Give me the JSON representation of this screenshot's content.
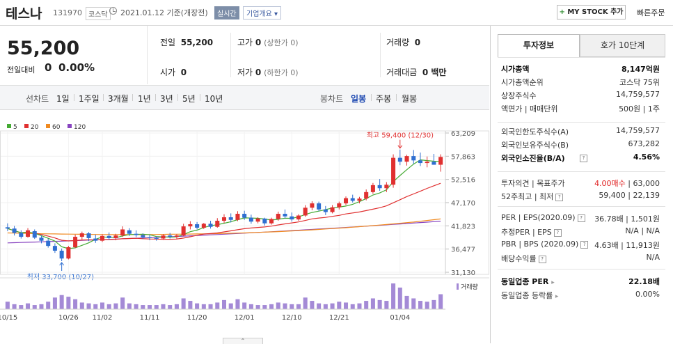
{
  "header": {
    "name": "테스나",
    "code": "131970",
    "market": "코스닥",
    "date": "2021.01.12 기준(개장전)",
    "realtime": "실시간",
    "company_info": "기업개요 ▾",
    "mystock": "MY STOCK 추가",
    "fast_order": "빠른주문"
  },
  "price": {
    "current": "55,200",
    "change_label": "전일대비",
    "change": "0",
    "change_pct": "0.00%"
  },
  "quote": {
    "prev_label": "전일",
    "prev": "55,200",
    "high_label": "고가",
    "high": "0",
    "upper": "(상한가 0)",
    "volume_label": "거래량",
    "volume": "0",
    "open_label": "시가",
    "open": "0",
    "low_label": "저가",
    "low": "0",
    "lower": "(하한가 0)",
    "amount_label": "거래대금",
    "amount": "0 백만"
  },
  "chart_tabs": {
    "line_label": "선차트",
    "line": [
      "1일",
      "1주일",
      "3개월",
      "1년",
      "3년",
      "5년",
      "10년"
    ],
    "candle_label": "봉차트",
    "candle": [
      "일봉",
      "주봉",
      "월봉"
    ],
    "active": "일봉"
  },
  "chart_data": {
    "type": "candlestick",
    "legend": [
      {
        "name": "5",
        "color": "#44aa33"
      },
      {
        "name": "20",
        "color": "#e03030"
      },
      {
        "name": "60",
        "color": "#f08a20"
      },
      {
        "name": "120",
        "color": "#8844c0"
      }
    ],
    "y_ticks": [
      "63,209",
      "57,863",
      "52,516",
      "47,170",
      "41,823",
      "36,477",
      "31,130"
    ],
    "ylim": [
      31130,
      63209
    ],
    "x_labels": [
      "10/15",
      "10/26",
      "11/02",
      "11/11",
      "11/20",
      "12/01",
      "12/10",
      "12/21",
      "01/04"
    ],
    "max_label": "최고 59,400 (12/30)",
    "min_label": "최저 33,700 (10/27)",
    "volume_label": "거래량",
    "candles": [
      [
        41500,
        42400,
        40600,
        41200
      ],
      [
        41200,
        41800,
        39600,
        40200
      ],
      [
        40200,
        40800,
        38900,
        39300
      ],
      [
        39300,
        41300,
        39100,
        40800
      ],
      [
        40600,
        41000,
        38800,
        39100
      ],
      [
        39100,
        39600,
        37800,
        38400
      ],
      [
        38400,
        38900,
        36800,
        37200
      ],
      [
        37200,
        37800,
        35600,
        36100
      ],
      [
        36100,
        36600,
        33700,
        34300
      ],
      [
        34300,
        37200,
        34100,
        36900
      ],
      [
        36900,
        39800,
        36700,
        39300
      ],
      [
        39300,
        40500,
        38700,
        40100
      ],
      [
        40100,
        40400,
        38300,
        39000
      ],
      [
        38900,
        39800,
        37900,
        38400
      ],
      [
        38400,
        39900,
        38100,
        39500
      ],
      [
        39500,
        40300,
        38600,
        39000
      ],
      [
        39000,
        40000,
        38500,
        39600
      ],
      [
        39600,
        41700,
        39300,
        41000
      ],
      [
        40800,
        41300,
        39500,
        40000
      ],
      [
        40000,
        40800,
        39200,
        39700
      ],
      [
        39700,
        40100,
        38800,
        39200
      ],
      [
        39200,
        39800,
        38500,
        39000
      ],
      [
        39000,
        39400,
        38400,
        38900
      ],
      [
        38900,
        39900,
        38600,
        39600
      ],
      [
        39600,
        40200,
        38900,
        39300
      ],
      [
        39300,
        39900,
        38800,
        39600
      ],
      [
        39600,
        42300,
        39400,
        41700
      ],
      [
        41700,
        42900,
        41000,
        42200
      ],
      [
        42200,
        42700,
        41000,
        41400
      ],
      [
        41400,
        42500,
        41100,
        42300
      ],
      [
        42300,
        43000,
        41200,
        41600
      ],
      [
        41600,
        43600,
        41400,
        43000
      ],
      [
        43000,
        44500,
        42500,
        43800
      ],
      [
        43800,
        44700,
        42600,
        43200
      ],
      [
        43200,
        45200,
        42900,
        44600
      ],
      [
        44600,
        45300,
        43200,
        43700
      ],
      [
        43700,
        44400,
        42300,
        42800
      ],
      [
        42800,
        43800,
        42400,
        43500
      ],
      [
        43500,
        43700,
        41900,
        42400
      ],
      [
        42400,
        43700,
        42100,
        43400
      ],
      [
        43400,
        45100,
        43000,
        44600
      ],
      [
        44600,
        45600,
        43500,
        44000
      ],
      [
        44000,
        44900,
        42800,
        43300
      ],
      [
        43300,
        44500,
        43000,
        44200
      ],
      [
        44200,
        46600,
        43900,
        46000
      ],
      [
        46000,
        47500,
        45400,
        47000
      ],
      [
        47000,
        47400,
        45200,
        45600
      ],
      [
        45600,
        46400,
        44300,
        45000
      ],
      [
        45000,
        46600,
        44700,
        46100
      ],
      [
        46100,
        47400,
        45600,
        47000
      ],
      [
        47000,
        48600,
        46600,
        48200
      ],
      [
        48200,
        49000,
        47200,
        47600
      ],
      [
        47600,
        48500,
        47000,
        48100
      ],
      [
        48100,
        50200,
        47700,
        49600
      ],
      [
        49600,
        51700,
        49200,
        51200
      ],
      [
        51200,
        52600,
        49900,
        50500
      ],
      [
        50500,
        51900,
        49600,
        51300
      ],
      [
        51300,
        58300,
        50600,
        57500
      ],
      [
        57500,
        59400,
        55800,
        56600
      ],
      [
        56600,
        58200,
        55700,
        57900
      ],
      [
        57900,
        59300,
        56100,
        56900
      ],
      [
        56900,
        58700,
        55600,
        56300
      ],
      [
        56300,
        57800,
        55300,
        56600
      ],
      [
        56600,
        58400,
        55900,
        55900
      ],
      [
        55900,
        58300,
        54300,
        57700
      ]
    ],
    "volumes": [
      9,
      6,
      5,
      7,
      5,
      6,
      9,
      14,
      17,
      15,
      12,
      8,
      7,
      6,
      8,
      6,
      7,
      14,
      7,
      6,
      5,
      5,
      5,
      6,
      5,
      6,
      13,
      10,
      7,
      6,
      6,
      8,
      11,
      7,
      12,
      8,
      6,
      5,
      5,
      6,
      8,
      7,
      6,
      6,
      14,
      10,
      7,
      6,
      7,
      9,
      8,
      6,
      7,
      10,
      13,
      11,
      10,
      31,
      26,
      16,
      13,
      10,
      9,
      11,
      18
    ]
  },
  "right": {
    "tab_invest": "투자정보",
    "tab_quote": "호가 10단계",
    "rows1": [
      {
        "k": "시가총액",
        "v": "8,147억원",
        "strong": true
      },
      {
        "k": "시가총액순위",
        "v": "코스닥 75위"
      },
      {
        "k": "상장주식수",
        "v": "14,759,577"
      },
      {
        "k": "액면가 | 매매단위",
        "v": "500원 | 1주"
      }
    ],
    "rows2": [
      {
        "k": "외국인한도주식수(A)",
        "v": "14,759,577"
      },
      {
        "k": "외국인보유주식수(B)",
        "v": "673,282"
      },
      {
        "k": "외국인소진율(B/A)",
        "v": "4.56%",
        "strong": true
      }
    ],
    "opinion_label": "투자의견 | 목표주가",
    "opinion": "4.00매수",
    "target": "63,000",
    "w52_label": "52주최고 | 최저",
    "w52": "59,400 | 22,139",
    "per_label": "PER | EPS(2020.09)",
    "per": "36.78배 | 1,501원",
    "eper_label": "추정PER | EPS",
    "eper": "N/A | N/A",
    "pbr_label": "PBR | BPS (2020.09)",
    "pbr": "4.63배 | 11,913원",
    "div_label": "배당수익률",
    "div": "N/A",
    "sector_per_label": "동일업종 PER",
    "sector_per": "22.18배",
    "sector_chg_label": "동일업종 등락률",
    "sector_chg": "0.00%"
  }
}
